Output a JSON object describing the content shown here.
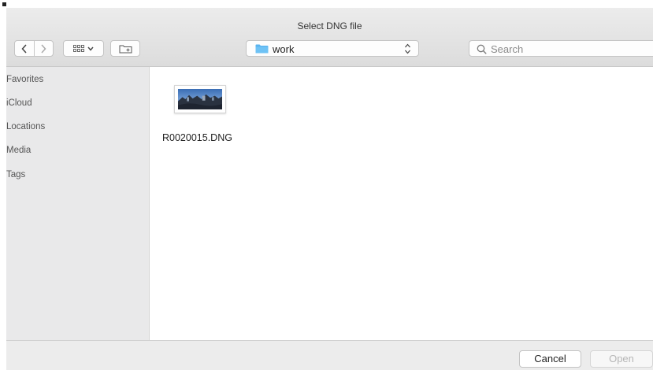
{
  "window": {
    "title": "Select DNG file"
  },
  "toolbar": {
    "back_icon": "chevron-left-icon",
    "forward_icon": "chevron-right-icon",
    "view_icon": "icon-grid-view-icon",
    "view_menu_icon": "chevron-down-icon",
    "new_folder_icon": "new-folder-icon",
    "path": {
      "label": "work",
      "folder_color": "#5ab4ef"
    },
    "search": {
      "value": "",
      "placeholder": "Search"
    }
  },
  "sidebar": {
    "items": [
      {
        "label": "Favorites"
      },
      {
        "label": "iCloud"
      },
      {
        "label": "Locations"
      },
      {
        "label": "Media"
      },
      {
        "label": "Tags"
      }
    ]
  },
  "files": [
    {
      "name": "R0020015.DNG"
    }
  ],
  "footer": {
    "cancel_label": "Cancel",
    "open_label": "Open"
  }
}
